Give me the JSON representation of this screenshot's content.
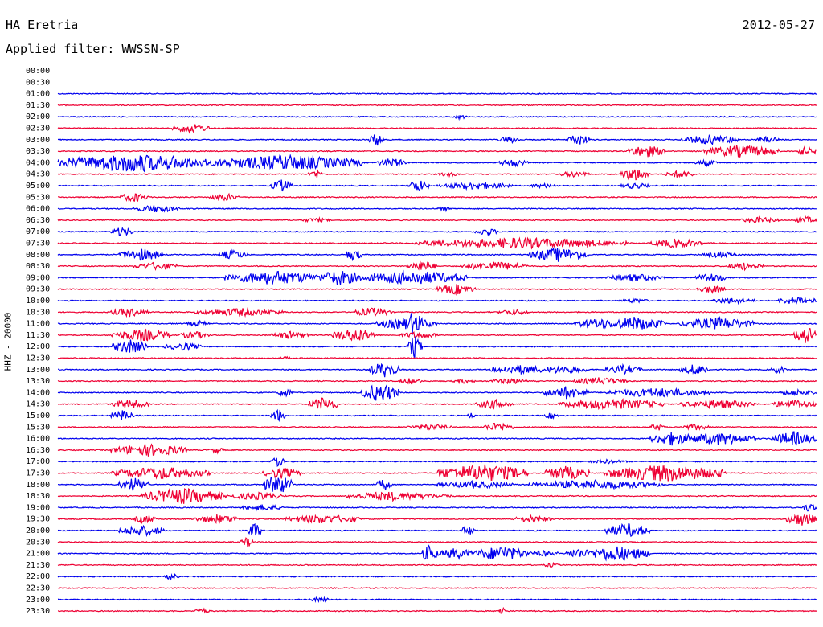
{
  "header": {
    "station": "HA Eretria",
    "date": "2012-05-27",
    "filter": "Applied filter: WWSSN-SP"
  },
  "chart_data": {
    "type": "line",
    "subtype": "helicorder",
    "ylabel": "HHZ - 20000",
    "time_labels": [
      "00:00",
      "00:30",
      "01:00",
      "01:30",
      "02:00",
      "02:30",
      "03:00",
      "03:30",
      "04:00",
      "04:30",
      "05:00",
      "05:30",
      "06:00",
      "06:30",
      "07:00",
      "07:30",
      "08:00",
      "08:30",
      "09:00",
      "09:30",
      "10:00",
      "10:30",
      "11:00",
      "11:30",
      "12:00",
      "12:30",
      "13:00",
      "13:30",
      "14:00",
      "14:30",
      "15:00",
      "15:30",
      "16:00",
      "16:30",
      "17:00",
      "17:30",
      "18:00",
      "18:30",
      "19:00",
      "19:30",
      "20:00",
      "20:30",
      "21:00",
      "21:30",
      "22:00",
      "22:30",
      "23:00",
      "23:30"
    ],
    "data_start_row": 2,
    "colors": [
      "#0000ee",
      "#ee0033"
    ],
    "grid": false,
    "activity": [
      [
        [
          1.0,
          0.0,
          2
        ]
      ],
      [],
      [
        [
          0.52,
          0.54,
          3
        ]
      ],
      [
        [
          0.15,
          0.2,
          6
        ]
      ],
      [
        [
          0.41,
          0.43,
          9
        ],
        [
          0.58,
          0.61,
          5
        ],
        [
          0.67,
          0.7,
          8
        ],
        [
          0.82,
          0.9,
          6
        ],
        [
          0.92,
          0.95,
          4
        ]
      ],
      [
        [
          0.75,
          0.8,
          8
        ],
        [
          0.85,
          0.95,
          8
        ],
        [
          0.97,
          1.0,
          6
        ]
      ],
      [
        [
          0.0,
          0.2,
          12
        ],
        [
          0.2,
          0.4,
          10
        ],
        [
          0.42,
          0.46,
          6
        ],
        [
          0.58,
          0.62,
          5
        ],
        [
          0.84,
          0.87,
          4
        ]
      ],
      [
        [
          0.33,
          0.35,
          6
        ],
        [
          0.5,
          0.53,
          3
        ],
        [
          0.66,
          0.7,
          4
        ],
        [
          0.74,
          0.78,
          9
        ],
        [
          0.8,
          0.84,
          5
        ]
      ],
      [
        [
          0.28,
          0.31,
          8
        ],
        [
          0.46,
          0.49,
          8
        ],
        [
          0.5,
          0.6,
          5
        ],
        [
          0.62,
          0.66,
          3
        ],
        [
          0.74,
          0.78,
          4
        ]
      ],
      [
        [
          0.08,
          0.12,
          6
        ],
        [
          0.2,
          0.24,
          5
        ]
      ],
      [
        [
          0.1,
          0.16,
          5
        ],
        [
          0.5,
          0.52,
          3
        ]
      ],
      [
        [
          0.32,
          0.36,
          3
        ],
        [
          0.9,
          0.95,
          4
        ],
        [
          0.97,
          1.0,
          5
        ]
      ],
      [
        [
          0.07,
          0.1,
          6
        ],
        [
          0.55,
          0.58,
          5
        ]
      ],
      [
        [
          0.47,
          0.75,
          7
        ],
        [
          0.78,
          0.85,
          6
        ]
      ],
      [
        [
          0.08,
          0.14,
          8
        ],
        [
          0.21,
          0.25,
          6
        ],
        [
          0.38,
          0.4,
          8
        ],
        [
          0.62,
          0.7,
          9
        ],
        [
          0.85,
          0.9,
          4
        ]
      ],
      [
        [
          0.1,
          0.16,
          5
        ],
        [
          0.46,
          0.5,
          7
        ],
        [
          0.53,
          0.62,
          6
        ],
        [
          0.88,
          0.93,
          5
        ]
      ],
      [
        [
          0.22,
          0.35,
          9
        ],
        [
          0.34,
          0.4,
          10
        ],
        [
          0.4,
          0.54,
          9
        ],
        [
          0.72,
          0.8,
          5
        ],
        [
          0.84,
          0.88,
          6
        ]
      ],
      [
        [
          0.5,
          0.55,
          7
        ],
        [
          0.84,
          0.88,
          5
        ]
      ],
      [
        [
          0.74,
          0.78,
          3
        ],
        [
          0.86,
          0.92,
          4
        ],
        [
          0.95,
          1.0,
          6
        ]
      ],
      [
        [
          0.07,
          0.12,
          6
        ],
        [
          0.18,
          0.3,
          5
        ],
        [
          0.39,
          0.44,
          6
        ],
        [
          0.58,
          0.62,
          4
        ]
      ],
      [
        [
          0.17,
          0.2,
          4
        ],
        [
          0.42,
          0.5,
          8
        ],
        [
          0.46,
          0.48,
          18
        ],
        [
          0.68,
          0.75,
          7
        ],
        [
          0.72,
          0.8,
          9
        ],
        [
          0.82,
          0.92,
          8
        ]
      ],
      [
        [
          0.07,
          0.15,
          8
        ],
        [
          0.16,
          0.2,
          5
        ],
        [
          0.28,
          0.33,
          5
        ],
        [
          0.36,
          0.42,
          9
        ],
        [
          0.45,
          0.5,
          5
        ],
        [
          0.97,
          1.0,
          12
        ]
      ],
      [
        [
          0.07,
          0.12,
          9
        ],
        [
          0.14,
          0.19,
          5
        ],
        [
          0.46,
          0.48,
          14
        ]
      ],
      [
        [
          0.29,
          0.31,
          2
        ]
      ],
      [
        [
          0.41,
          0.45,
          10
        ],
        [
          0.57,
          0.65,
          6
        ],
        [
          0.63,
          0.7,
          5
        ],
        [
          0.72,
          0.77,
          6
        ],
        [
          0.82,
          0.86,
          7
        ],
        [
          0.94,
          0.96,
          5
        ]
      ],
      [
        [
          0.45,
          0.48,
          4
        ],
        [
          0.52,
          0.55,
          3
        ],
        [
          0.57,
          0.62,
          4
        ],
        [
          0.68,
          0.75,
          5
        ]
      ],
      [
        [
          0.29,
          0.31,
          6
        ],
        [
          0.4,
          0.45,
          12
        ],
        [
          0.64,
          0.7,
          8
        ],
        [
          0.72,
          0.86,
          6
        ],
        [
          0.95,
          1.0,
          4
        ]
      ],
      [
        [
          0.07,
          0.12,
          6
        ],
        [
          0.33,
          0.37,
          9
        ],
        [
          0.55,
          0.6,
          6
        ],
        [
          0.66,
          0.8,
          7
        ],
        [
          0.82,
          0.92,
          6
        ],
        [
          0.94,
          1.0,
          6
        ]
      ],
      [
        [
          0.07,
          0.1,
          7
        ],
        [
          0.28,
          0.3,
          8
        ],
        [
          0.54,
          0.55,
          4
        ],
        [
          0.64,
          0.66,
          4
        ]
      ],
      [
        [
          0.46,
          0.52,
          4
        ],
        [
          0.56,
          0.6,
          6
        ],
        [
          0.78,
          0.8,
          5
        ],
        [
          0.82,
          0.86,
          4
        ]
      ],
      [
        [
          0.78,
          0.84,
          9
        ],
        [
          0.82,
          0.92,
          8
        ],
        [
          0.94,
          1.0,
          9
        ]
      ],
      [
        [
          0.07,
          0.17,
          8
        ],
        [
          0.2,
          0.22,
          4
        ]
      ],
      [
        [
          0.28,
          0.3,
          6
        ],
        [
          0.7,
          0.75,
          3
        ]
      ],
      [
        [
          0.07,
          0.2,
          8
        ],
        [
          0.27,
          0.32,
          7
        ],
        [
          0.5,
          0.62,
          12
        ],
        [
          0.64,
          0.7,
          9
        ],
        [
          0.72,
          0.88,
          11
        ]
      ],
      [
        [
          0.08,
          0.12,
          9
        ],
        [
          0.27,
          0.31,
          13
        ],
        [
          0.42,
          0.44,
          8
        ],
        [
          0.5,
          0.6,
          5
        ],
        [
          0.62,
          0.8,
          6
        ]
      ],
      [
        [
          0.11,
          0.22,
          10
        ],
        [
          0.22,
          0.3,
          5
        ],
        [
          0.38,
          0.5,
          6
        ],
        [
          0.5,
          0.52,
          3
        ]
      ],
      [
        [
          0.24,
          0.3,
          4
        ],
        [
          0.98,
          1.0,
          6
        ]
      ],
      [
        [
          0.1,
          0.13,
          6
        ],
        [
          0.18,
          0.24,
          6
        ],
        [
          0.3,
          0.4,
          6
        ],
        [
          0.6,
          0.65,
          5
        ],
        [
          0.96,
          1.0,
          9
        ]
      ],
      [
        [
          0.08,
          0.14,
          7
        ],
        [
          0.25,
          0.27,
          9
        ],
        [
          0.53,
          0.55,
          7
        ],
        [
          0.72,
          0.78,
          9
        ]
      ],
      [
        [
          0.24,
          0.26,
          6
        ]
      ],
      [
        [
          0.48,
          0.5,
          12
        ],
        [
          0.5,
          0.55,
          7
        ],
        [
          0.55,
          0.62,
          10
        ],
        [
          0.62,
          0.66,
          4
        ],
        [
          0.67,
          0.7,
          7
        ],
        [
          0.69,
          0.78,
          10
        ]
      ],
      [
        [
          0.64,
          0.66,
          3
        ]
      ],
      [
        [
          0.14,
          0.16,
          4
        ]
      ],
      [],
      [
        [
          0.33,
          0.36,
          3
        ]
      ],
      [
        [
          0.18,
          0.2,
          4
        ],
        [
          0.58,
          0.59,
          8
        ]
      ]
    ]
  }
}
